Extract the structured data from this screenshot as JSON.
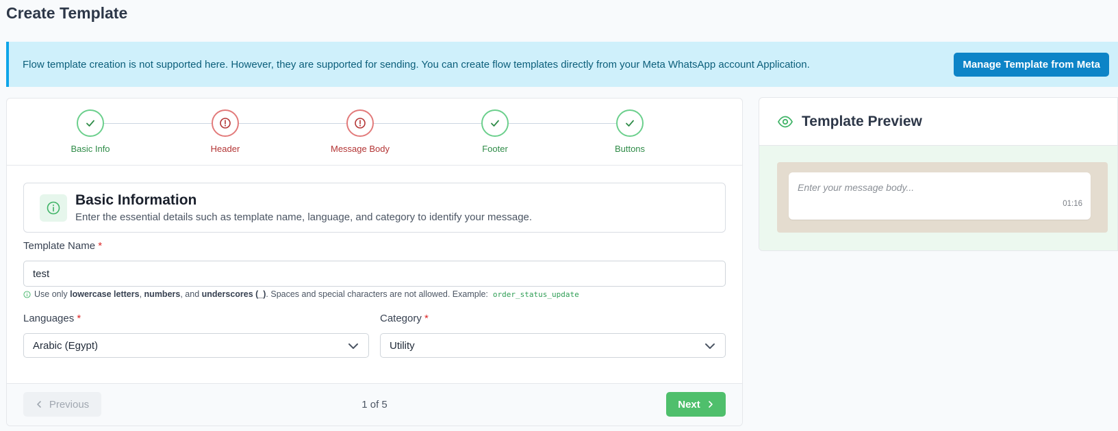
{
  "page": {
    "title": "Create Template"
  },
  "alert": {
    "text": "Flow template creation is not supported here. However, they are supported for sending. You can create flow templates directly from your Meta WhatsApp account Application.",
    "button_label": "Manage Template from Meta"
  },
  "stepper": {
    "steps": [
      {
        "label": "Basic Info",
        "status": "complete"
      },
      {
        "label": "Header",
        "status": "error"
      },
      {
        "label": "Message Body",
        "status": "error"
      },
      {
        "label": "Footer",
        "status": "complete"
      },
      {
        "label": "Buttons",
        "status": "complete"
      }
    ]
  },
  "basic_info": {
    "title": "Basic Information",
    "description": "Enter the essential details such as template name, language, and category to identify your message."
  },
  "form": {
    "template_name": {
      "label": "Template Name",
      "required_mark": "*",
      "value": "test"
    },
    "hint": {
      "prefix": "Use only",
      "bold1": "lowercase letters",
      "sep1": ",",
      "bold2": "numbers",
      "sep2": ", and",
      "bold3": "underscores (_)",
      "suffix": ". Spaces and special characters are not allowed. Example:",
      "example": "order_status_update"
    },
    "languages": {
      "label": "Languages",
      "required_mark": "*",
      "value": "Arabic (Egypt)"
    },
    "category": {
      "label": "Category",
      "required_mark": "*",
      "value": "Utility"
    }
  },
  "pager": {
    "previous_label": "Previous",
    "indicator": "1 of 5",
    "next_label": "Next"
  },
  "preview": {
    "title": "Template Preview",
    "placeholder": "Enter your message body...",
    "time": "01:16"
  },
  "colors": {
    "accent_blue": "#0d84c7",
    "success_green": "#4fbf6c",
    "error_red": "#e27a7a",
    "alert_bg": "#cff0fb"
  }
}
